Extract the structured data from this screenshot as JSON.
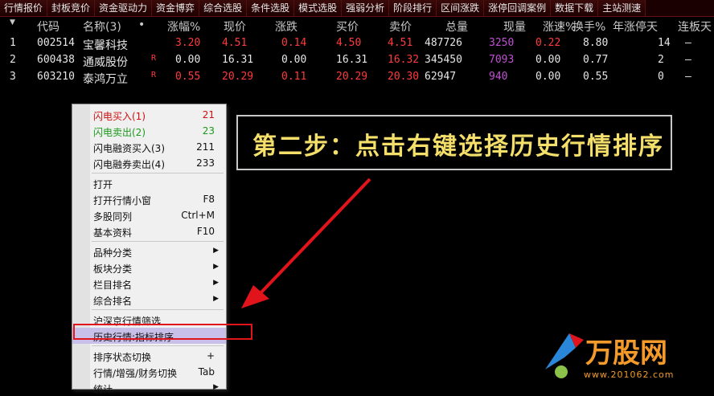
{
  "tabs": [
    "行情报价",
    "封板竞价",
    "资金驱动力",
    "资金博弈",
    "综合选股",
    "条件选股",
    "模式选股",
    "强弱分析",
    "阶段排行",
    "区间涨跌",
    "涨停回调案例",
    "数据下载",
    "主站测速"
  ],
  "columns": [
    "",
    "代码",
    "名称(3)",
    "•",
    "涨幅%",
    "现价",
    "涨跌",
    "买价",
    "卖价",
    "总量",
    "现量",
    "涨速%",
    "换手%",
    "年涨停天",
    "连板天"
  ],
  "rows": [
    {
      "idx": "1",
      "code": "002514",
      "name": "宝馨科技",
      "flag": "",
      "pct": "3.20",
      "price": "4.51",
      "chg": "0.14",
      "bid": "4.50",
      "ask": "4.51",
      "vol": "487726",
      "cur": "3250",
      "spd": "0.22",
      "turn": "8.80",
      "ytd": "14",
      "lb": "—",
      "colors": {
        "pct": "#ff3b3b",
        "price": "#ff3b3b",
        "chg": "#ff3b3b",
        "bid": "#ff3b3b",
        "ask": "#ff3b3b",
        "cur": "#c24fd6",
        "spd": "#ff3b3b"
      }
    },
    {
      "idx": "2",
      "code": "600438",
      "name": "通威股份",
      "flag": "R",
      "pct": "0.00",
      "price": "16.31",
      "chg": "0.00",
      "bid": "16.31",
      "ask": "16.32",
      "vol": "345450",
      "cur": "7093",
      "spd": "0.00",
      "turn": "0.77",
      "ytd": "2",
      "lb": "—",
      "colors": {
        "pct": "#e6e6e6",
        "price": "#e6e6e6",
        "chg": "#e6e6e6",
        "bid": "#e6e6e6",
        "ask": "#ff3b3b",
        "cur": "#c24fd6",
        "spd": "#e6e6e6"
      }
    },
    {
      "idx": "3",
      "code": "603210",
      "name": "泰鸿万立",
      "flag": "R",
      "pct": "0.55",
      "price": "20.29",
      "chg": "0.11",
      "bid": "20.29",
      "ask": "20.30",
      "vol": "62947",
      "cur": "940",
      "spd": "0.00",
      "turn": "0.55",
      "ytd": "0",
      "lb": "—",
      "colors": {
        "pct": "#ff3b3b",
        "price": "#ff3b3b",
        "chg": "#ff3b3b",
        "bid": "#ff3b3b",
        "ask": "#ff3b3b",
        "cur": "#c24fd6",
        "spd": "#e6e6e6"
      }
    }
  ],
  "menu": [
    {
      "label": "闪电买入(1)",
      "shortcut": "21",
      "color": "#d01010"
    },
    {
      "label": "闪电卖出(2)",
      "shortcut": "23",
      "color": "#1a9a1a"
    },
    {
      "label": "闪电融资买入(3)",
      "shortcut": "211"
    },
    {
      "label": "闪电融券卖出(4)",
      "shortcut": "233"
    },
    {
      "sep": true
    },
    {
      "label": "打开",
      "shortcut": ""
    },
    {
      "label": "打开行情小窗",
      "shortcut": "F8"
    },
    {
      "label": "多股同列",
      "shortcut": "Ctrl+M"
    },
    {
      "label": "基本资料",
      "shortcut": "F10"
    },
    {
      "sep": true
    },
    {
      "label": "品种分类",
      "arrow": true
    },
    {
      "label": "板块分类",
      "arrow": true
    },
    {
      "label": "栏目排名",
      "arrow": true
    },
    {
      "label": "综合排名",
      "arrow": true
    },
    {
      "sep": true
    },
    {
      "label": "沪深京行情筛选",
      "shortcut": ""
    },
    {
      "label": "历史行情:指标排序",
      "shortcut": "",
      "highlight": true
    },
    {
      "sep": true
    },
    {
      "label": "排序状态切换",
      "shortcut": "+"
    },
    {
      "label": "行情/增强/财务切换",
      "shortcut": "Tab"
    },
    {
      "label": "统计",
      "arrow": true
    }
  ],
  "callout": "第二步：点击右键选择历史行情排序",
  "logo": {
    "text": "万股网",
    "url": "www.201062.com"
  },
  "colors": {
    "accent_red": "#e0141a",
    "callout_text": "#f4df6a",
    "logo_orange": "#f39a2a"
  }
}
